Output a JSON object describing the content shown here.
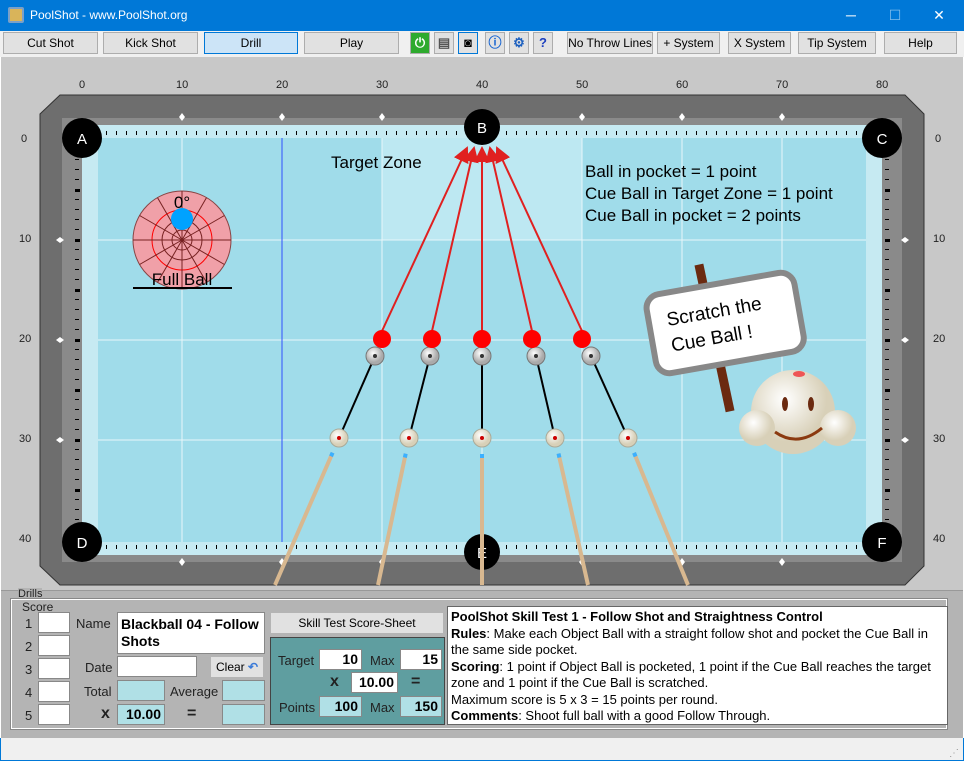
{
  "window": {
    "title": "PoolShot - www.PoolShot.org",
    "minimize": "─",
    "maximize": "☐",
    "close": "✕"
  },
  "toolbar": {
    "buttons": [
      {
        "label": "Cut Shot"
      },
      {
        "label": "Kick Shot"
      },
      {
        "label": "Drill",
        "active": true
      },
      {
        "label": "Play"
      }
    ],
    "icons": [
      "power-icon",
      "printer-icon",
      "camera-icon",
      "info-icon",
      "gear-icon",
      "help-document-icon"
    ],
    "right_buttons": [
      {
        "label": "No Throw Lines"
      },
      {
        "label": "+ System"
      },
      {
        "label": "X System"
      },
      {
        "label": "Tip System"
      },
      {
        "label": "Help"
      }
    ]
  },
  "table": {
    "x_ruler": [
      "0",
      "10",
      "20",
      "30",
      "40",
      "50",
      "60",
      "70",
      "80"
    ],
    "y_ruler": [
      "0",
      "10",
      "20",
      "30",
      "40"
    ],
    "pockets": {
      "a": "A",
      "b": "B",
      "c": "C",
      "d": "D",
      "e": "E",
      "f": "F"
    },
    "target_zone_label": "Target Zone",
    "scoring_lines": [
      "Ball in pocket = 1 point",
      "Cue Ball in Target Zone = 1 point",
      "Cue Ball in pocket = 2 points"
    ],
    "aim": {
      "angle": "0°",
      "label": "Full Ball"
    },
    "sign": {
      "line1": "Scratch the",
      "line2": "Cue Ball !"
    },
    "colors": {
      "felt": "#a0dcea",
      "object_ball": "#ff0000",
      "arrow": "#e02020",
      "aim_dot": "#00a2ff"
    }
  },
  "drills": {
    "group_label": "Drills",
    "score": {
      "group_label": "Score",
      "rows": [
        "1",
        "2",
        "3",
        "4",
        "5"
      ],
      "name_label": "Name",
      "name_value": "Blackball 04 - Follow Shots",
      "date_label": "Date",
      "date_value": "",
      "clear_label": "Clear",
      "total_label": "Total",
      "average_label": "Average",
      "x_label": "x",
      "multiplier": "10.00",
      "equals": "="
    },
    "skill_test": {
      "button_label": "Skill Test Score-Sheet",
      "target_label": "Target",
      "target_value": "10",
      "max_label": "Max",
      "max_value": "15",
      "x_label": "x",
      "multiplier": "10.00",
      "equals": "=",
      "points_label": "Points",
      "points_value": "100",
      "points_max_label": "Max",
      "points_max_value": "150"
    },
    "description": {
      "title": "PoolShot Skill Test 1 - Follow Shot and Straightness Control",
      "rules_label": "Rules",
      "rules": ": Make each Object Ball with a straight follow shot and pocket the Cue Ball in the same side pocket.",
      "scoring_label": "Scoring",
      "scoring": ": 1 point if Object Ball is pocketed, 1 point if the Cue Ball reaches the target zone and 1 point if the Cue Ball is scratched.",
      "max_line": "Maximum score is 5 x 3 = 15 points per round.",
      "comments_label": "Comments",
      "comments": ": Shoot full ball with a good Follow Through."
    }
  }
}
